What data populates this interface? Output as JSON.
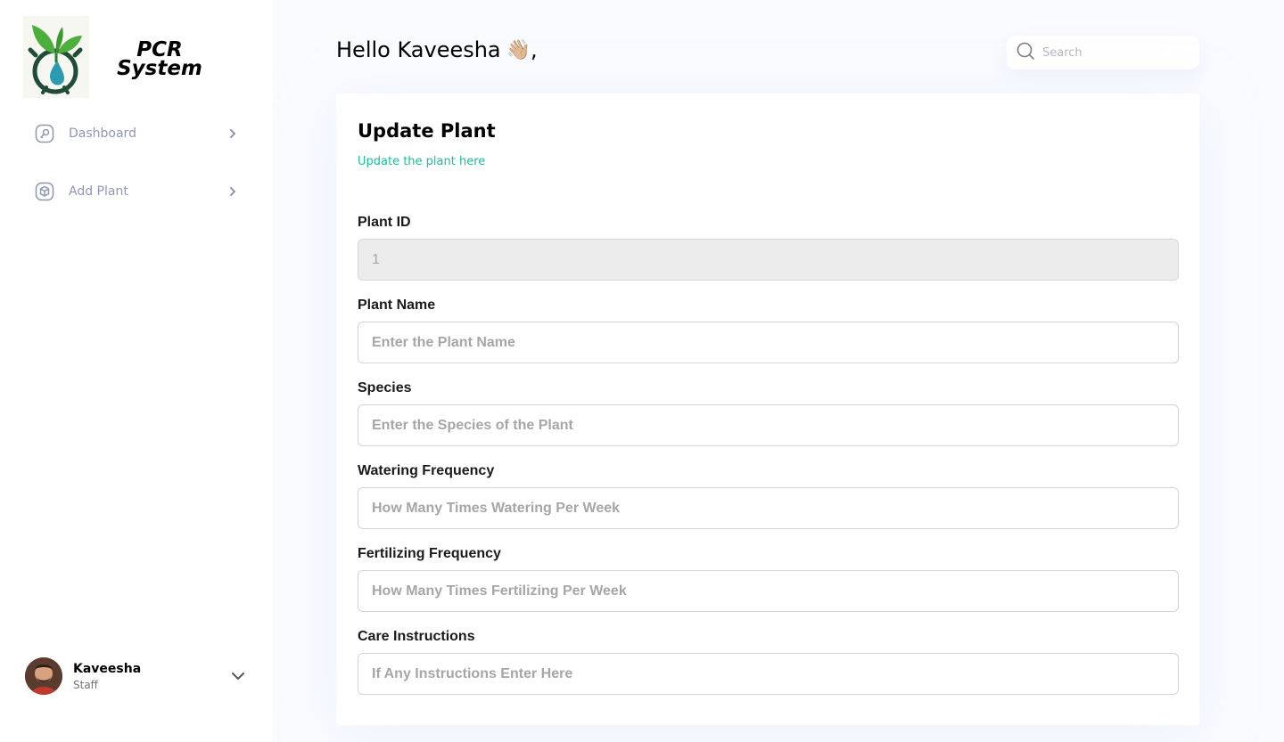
{
  "sidebar": {
    "brand": {
      "line1": "PCR",
      "line2": "System"
    },
    "nav": [
      {
        "label": "Dashboard",
        "icon": "key-square-icon"
      },
      {
        "label": "Add Plant",
        "icon": "cube-icon"
      }
    ],
    "profile": {
      "name": "Kaveesha",
      "role": "Staff"
    }
  },
  "header": {
    "greeting": "Hello Kaveesha",
    "wave": "👋🏼",
    "comma": ",",
    "search_placeholder": "Search"
  },
  "form": {
    "title": "Update Plant",
    "subtitle": "Update the plant here",
    "fields": [
      {
        "label": "Plant ID",
        "value": "1",
        "placeholder": "",
        "disabled": true
      },
      {
        "label": "Plant Name",
        "value": "",
        "placeholder": "Enter the Plant Name"
      },
      {
        "label": "Species",
        "value": "",
        "placeholder": "Enter the Species of the Plant"
      },
      {
        "label": "Watering Frequency",
        "value": "",
        "placeholder": "How Many Times Watering Per Week"
      },
      {
        "label": "Fertilizing Frequency",
        "value": "",
        "placeholder": "How Many Times Fertilizing Per Week"
      },
      {
        "label": "Care Instructions",
        "value": "",
        "placeholder": "If Any Instructions Enter Here"
      }
    ]
  },
  "colors": {
    "accent": "#16c098",
    "nav_text": "#9197b3",
    "background": "#fafbff"
  }
}
